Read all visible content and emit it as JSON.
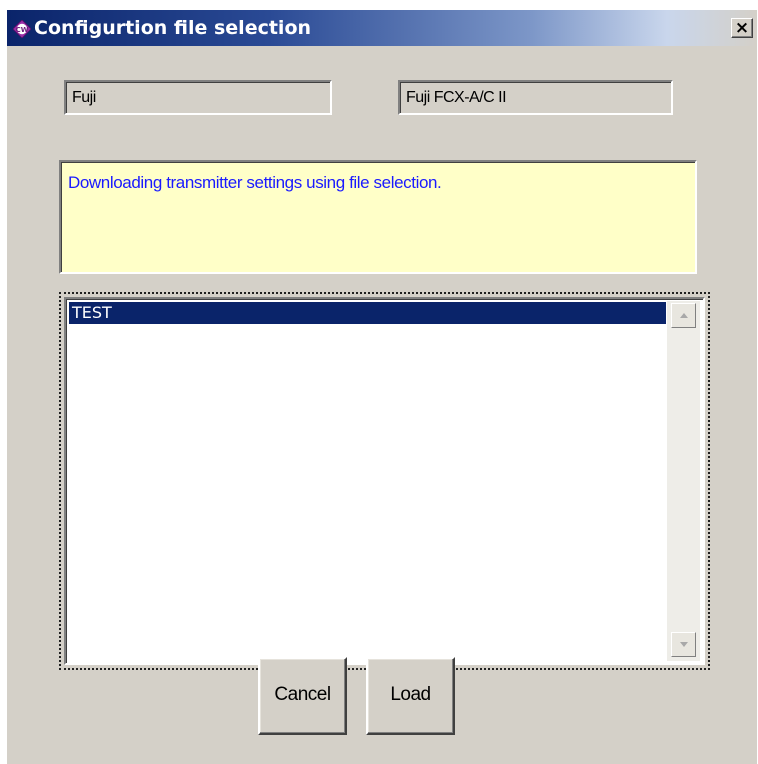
{
  "window": {
    "title": "Configurtion file selection",
    "close_symbol": "×",
    "icon": "cw-app-icon"
  },
  "fields": {
    "manufacturer": "Fuji",
    "model": "Fuji FCX-A/C II"
  },
  "message": "Downloading transmitter settings using file selection.",
  "file_list": {
    "items": [
      "TEST"
    ],
    "selected_index": 0
  },
  "buttons": {
    "cancel": "Cancel",
    "load": "Load"
  },
  "colors": {
    "titlebar_active": "#0a246a",
    "message_background": "#ffffc8",
    "message_text": "#1a1aff",
    "selection": "#0a246a",
    "dialog_face": "#d4d0c8"
  }
}
